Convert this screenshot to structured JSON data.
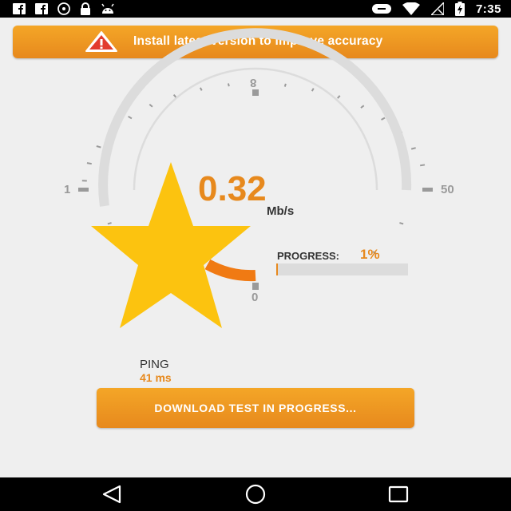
{
  "status_bar": {
    "time": "7:35",
    "left_icons": [
      "facebook-icon",
      "facebook-icon",
      "disc-icon",
      "lock-icon",
      "android-icon"
    ],
    "right_icons": [
      "toggle-icon",
      "wifi-icon",
      "no-signal-icon",
      "battery-charging-icon"
    ]
  },
  "banner": {
    "text": "Install latest version to improve accuracy",
    "icon": "warning-icon"
  },
  "gauge": {
    "speed_value": "0.32",
    "speed_unit": "Mb/s",
    "min_label": "1",
    "max_label": "50",
    "zero_label": "0",
    "top_label": "8",
    "needle_fraction": 0.0064
  },
  "progress": {
    "label": "PROGRESS:",
    "value": "1%",
    "percent": 1
  },
  "ping": {
    "label": "PING",
    "value": "41 ms"
  },
  "download_button": {
    "label": "DOWNLOAD TEST IN PROGRESS..."
  },
  "nav_bar": {
    "icons": [
      "back-icon",
      "home-icon",
      "recents-icon"
    ]
  },
  "colors": {
    "accent": "#e7891d",
    "star": "#fcc30f",
    "background": "#efefef"
  }
}
